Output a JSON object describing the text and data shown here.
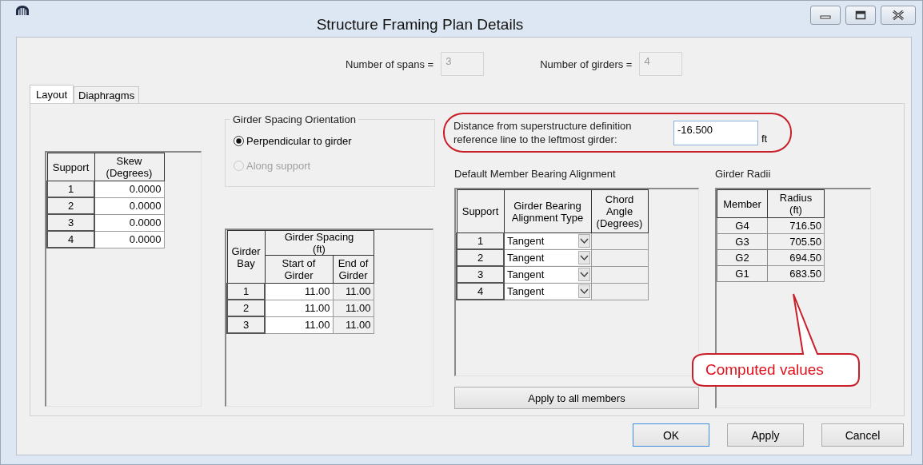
{
  "window": {
    "title": "Structure Framing Plan Details"
  },
  "header": {
    "spans": {
      "label": "Number of spans =",
      "value": "3",
      "disabled": true
    },
    "girders": {
      "label": "Number of girders =",
      "value": "4",
      "disabled": true
    }
  },
  "tabs": [
    {
      "label": "Layout",
      "selected": true
    },
    {
      "label": "Diaphragms",
      "selected": false
    }
  ],
  "skew_table": {
    "columns": [
      "Support",
      "Skew\n(Degrees)"
    ],
    "rows": [
      {
        "support": "1",
        "skew": "0.0000"
      },
      {
        "support": "2",
        "skew": "0.0000"
      },
      {
        "support": "3",
        "skew": "0.0000"
      },
      {
        "support": "4",
        "skew": "0.0000"
      }
    ]
  },
  "orientation": {
    "title": "Girder Spacing Orientation",
    "options": [
      {
        "label": "Perpendicular to girder",
        "selected": true,
        "disabled": false
      },
      {
        "label": "Along support",
        "selected": false,
        "disabled": true
      }
    ]
  },
  "spacing_table": {
    "bay_column": "Girder\nBay",
    "group_column": "Girder Spacing\n(ft)",
    "columns": [
      "Start of\nGirder",
      "End of\nGirder"
    ],
    "rows": [
      {
        "bay": "1",
        "start": "11.00",
        "end": "11.00"
      },
      {
        "bay": "2",
        "start": "11.00",
        "end": "11.00"
      },
      {
        "bay": "3",
        "start": "11.00",
        "end": "11.00"
      }
    ]
  },
  "distance": {
    "label": "Distance from superstructure definition\nreference line to the leftmost girder:",
    "value": "-16.500",
    "unit": "ft"
  },
  "bearing": {
    "title": "Default Member Bearing Alignment",
    "columns": [
      "Support",
      "Girder Bearing\nAlignment Type",
      "Chord\nAngle\n(Degrees)"
    ],
    "rows": [
      {
        "support": "1",
        "type": "Tangent"
      },
      {
        "support": "2",
        "type": "Tangent"
      },
      {
        "support": "3",
        "type": "Tangent"
      },
      {
        "support": "4",
        "type": "Tangent"
      }
    ],
    "button": "Apply to all members"
  },
  "radii": {
    "title": "Girder Radii",
    "columns": [
      "Member",
      "Radius\n(ft)"
    ],
    "rows": [
      {
        "member": "G4",
        "radius": "716.50"
      },
      {
        "member": "G3",
        "radius": "705.50"
      },
      {
        "member": "G2",
        "radius": "694.50"
      },
      {
        "member": "G1",
        "radius": "683.50"
      }
    ]
  },
  "callout": {
    "text": "Computed values"
  },
  "buttons": [
    {
      "label": "OK",
      "focused": true
    },
    {
      "label": "Apply",
      "focused": false
    },
    {
      "label": "Cancel",
      "focused": false
    }
  ]
}
